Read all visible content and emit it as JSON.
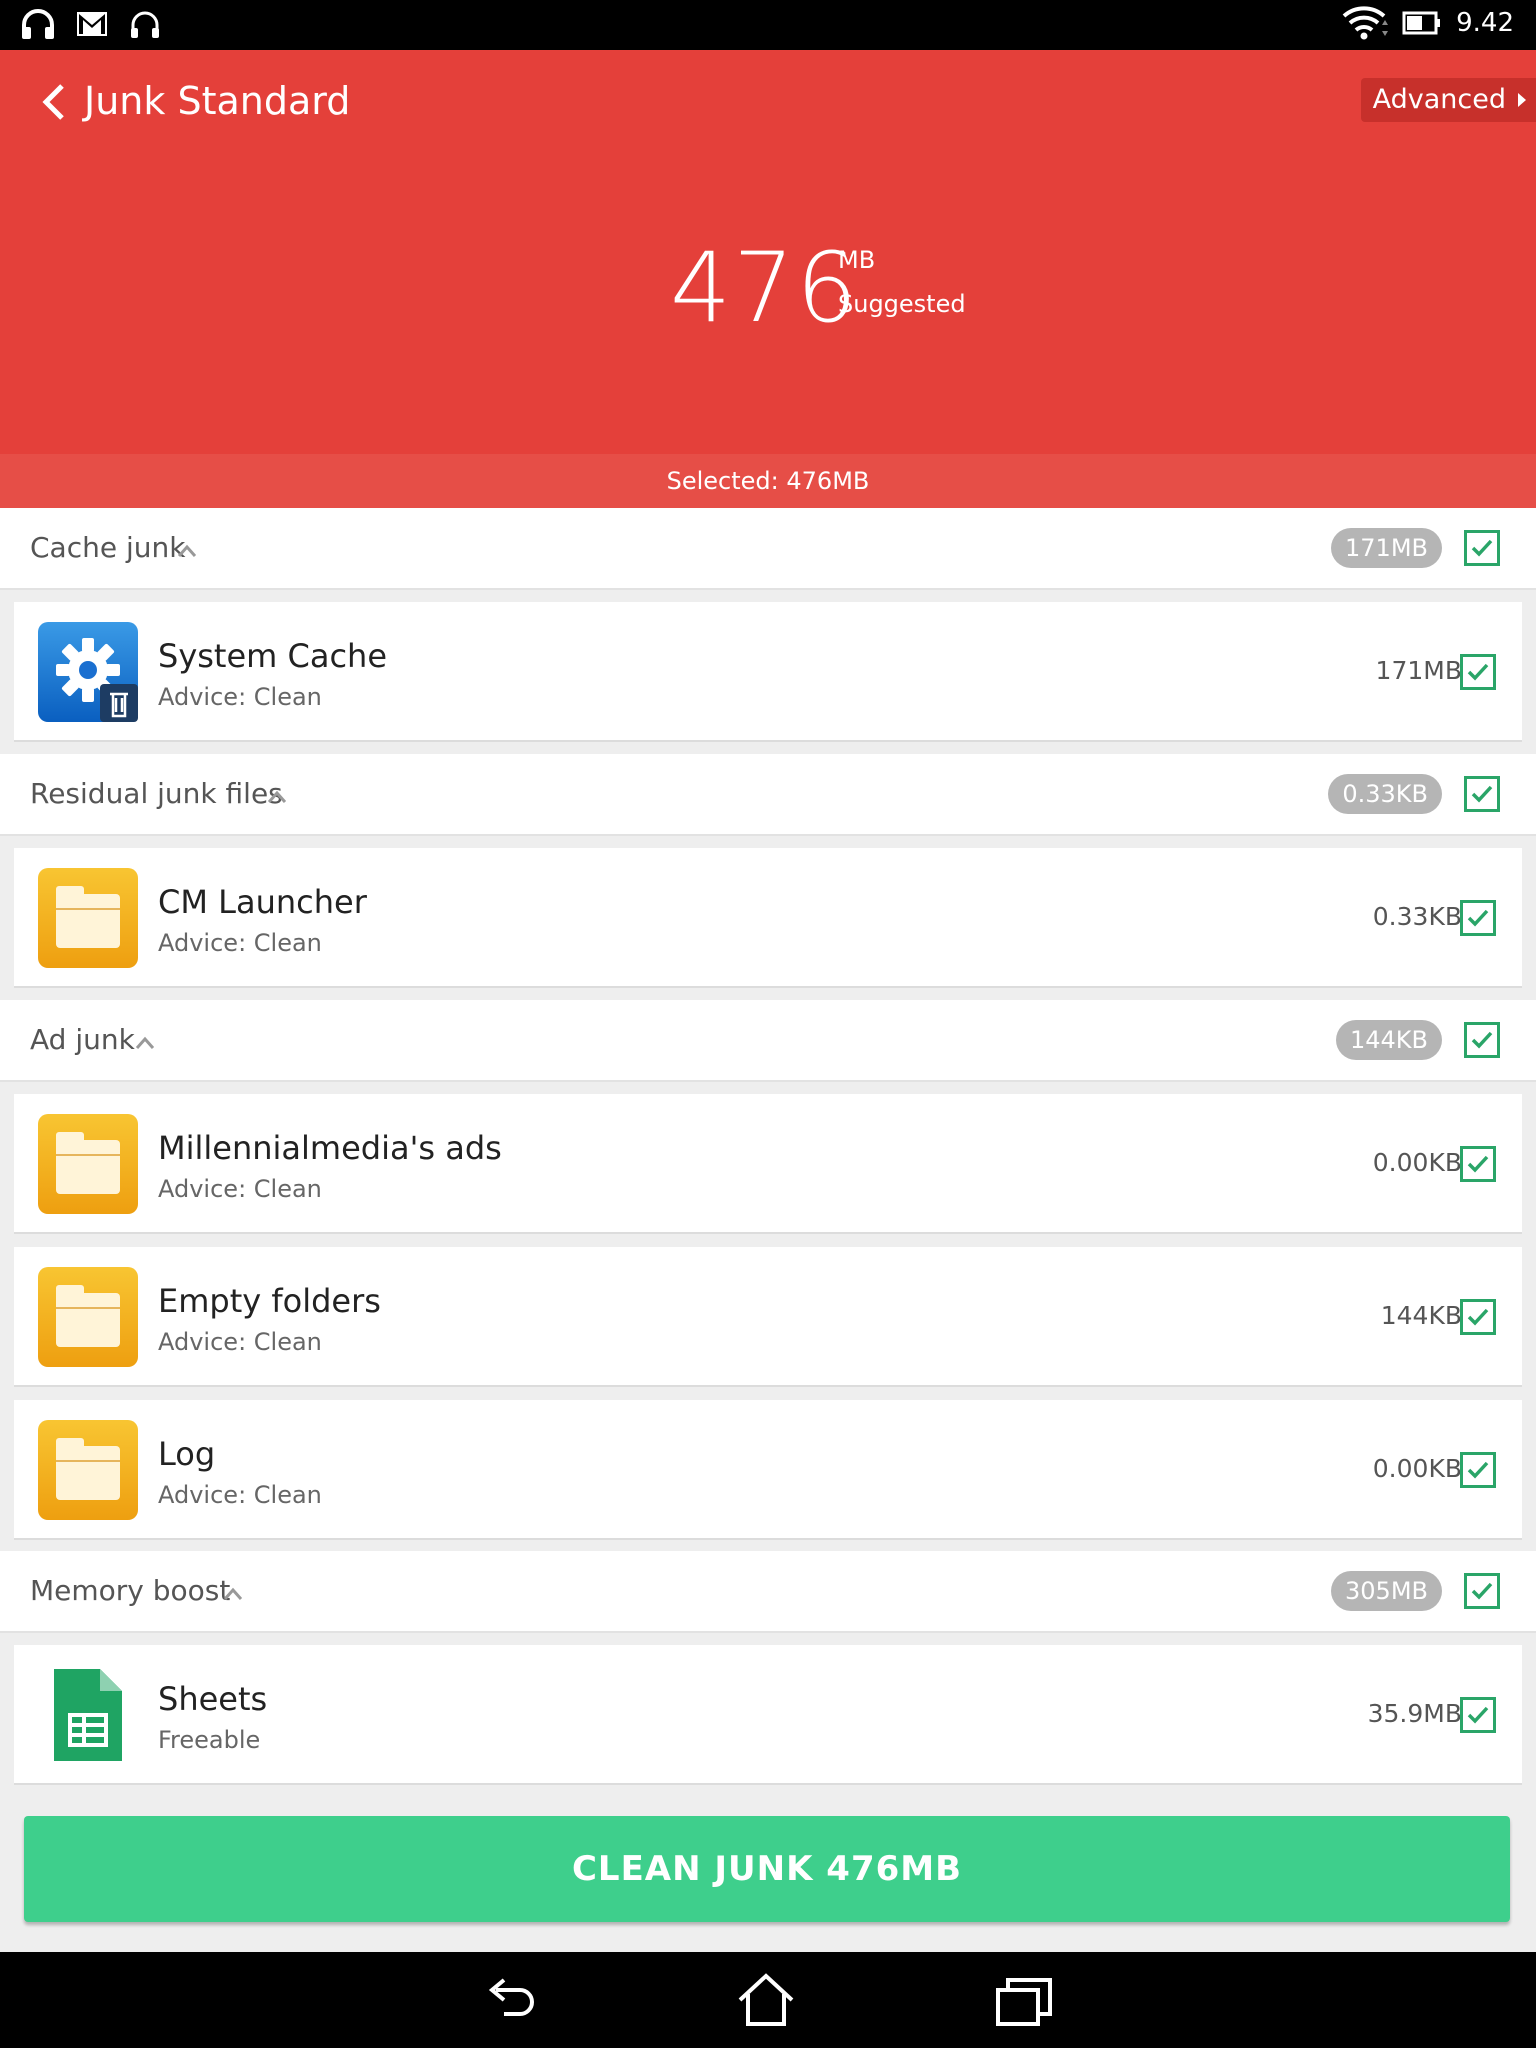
{
  "status_bar": {
    "time": "9.42",
    "icons": [
      "headphones-icon",
      "gmail-icon",
      "headset-icon",
      "wifi-icon",
      "battery-icon"
    ]
  },
  "header": {
    "title": "Junk Standard",
    "advanced_label": "Advanced",
    "total_value": "476",
    "total_unit": "MB",
    "suggested_label": "Suggested",
    "selected_text": "Selected: 476MB"
  },
  "colors": {
    "header_red": "#e4403a",
    "selected_bar": "#e64e47",
    "check_green": "#2aa568",
    "button_green": "#3ecf8c",
    "pill_gray": "#b5b5b5"
  },
  "sections": [
    {
      "label": "Cache junk",
      "size": "171MB",
      "checked": true,
      "items": [
        {
          "name": "System Cache",
          "sub": "Advice: Clean",
          "size": "171MB",
          "icon": "system-cache-icon",
          "checked": true
        }
      ]
    },
    {
      "label": "Residual junk files",
      "size": "0.33KB",
      "checked": true,
      "items": [
        {
          "name": "CM Launcher",
          "sub": "Advice: Clean",
          "size": "0.33KB",
          "icon": "folder-icon",
          "checked": true
        }
      ]
    },
    {
      "label": "Ad junk",
      "size": "144KB",
      "checked": true,
      "items": [
        {
          "name": "Millennialmedia's ads",
          "sub": "Advice: Clean",
          "size": "0.00KB",
          "icon": "folder-icon",
          "checked": true
        },
        {
          "name": "Empty folders",
          "sub": "Advice: Clean",
          "size": "144KB",
          "icon": "folder-icon",
          "checked": true
        },
        {
          "name": "Log",
          "sub": "Advice: Clean",
          "size": "0.00KB",
          "icon": "folder-icon",
          "checked": true
        }
      ]
    },
    {
      "label": "Memory boost",
      "size": "305MB",
      "checked": true,
      "items": [
        {
          "name": "Sheets",
          "sub": "Freeable",
          "size": "35.9MB",
          "icon": "sheets-icon",
          "checked": true
        }
      ]
    }
  ],
  "clean_button": {
    "label": "CLEAN JUNK 476MB"
  },
  "navigation": [
    "back-nav-icon",
    "home-nav-icon",
    "recents-nav-icon"
  ]
}
